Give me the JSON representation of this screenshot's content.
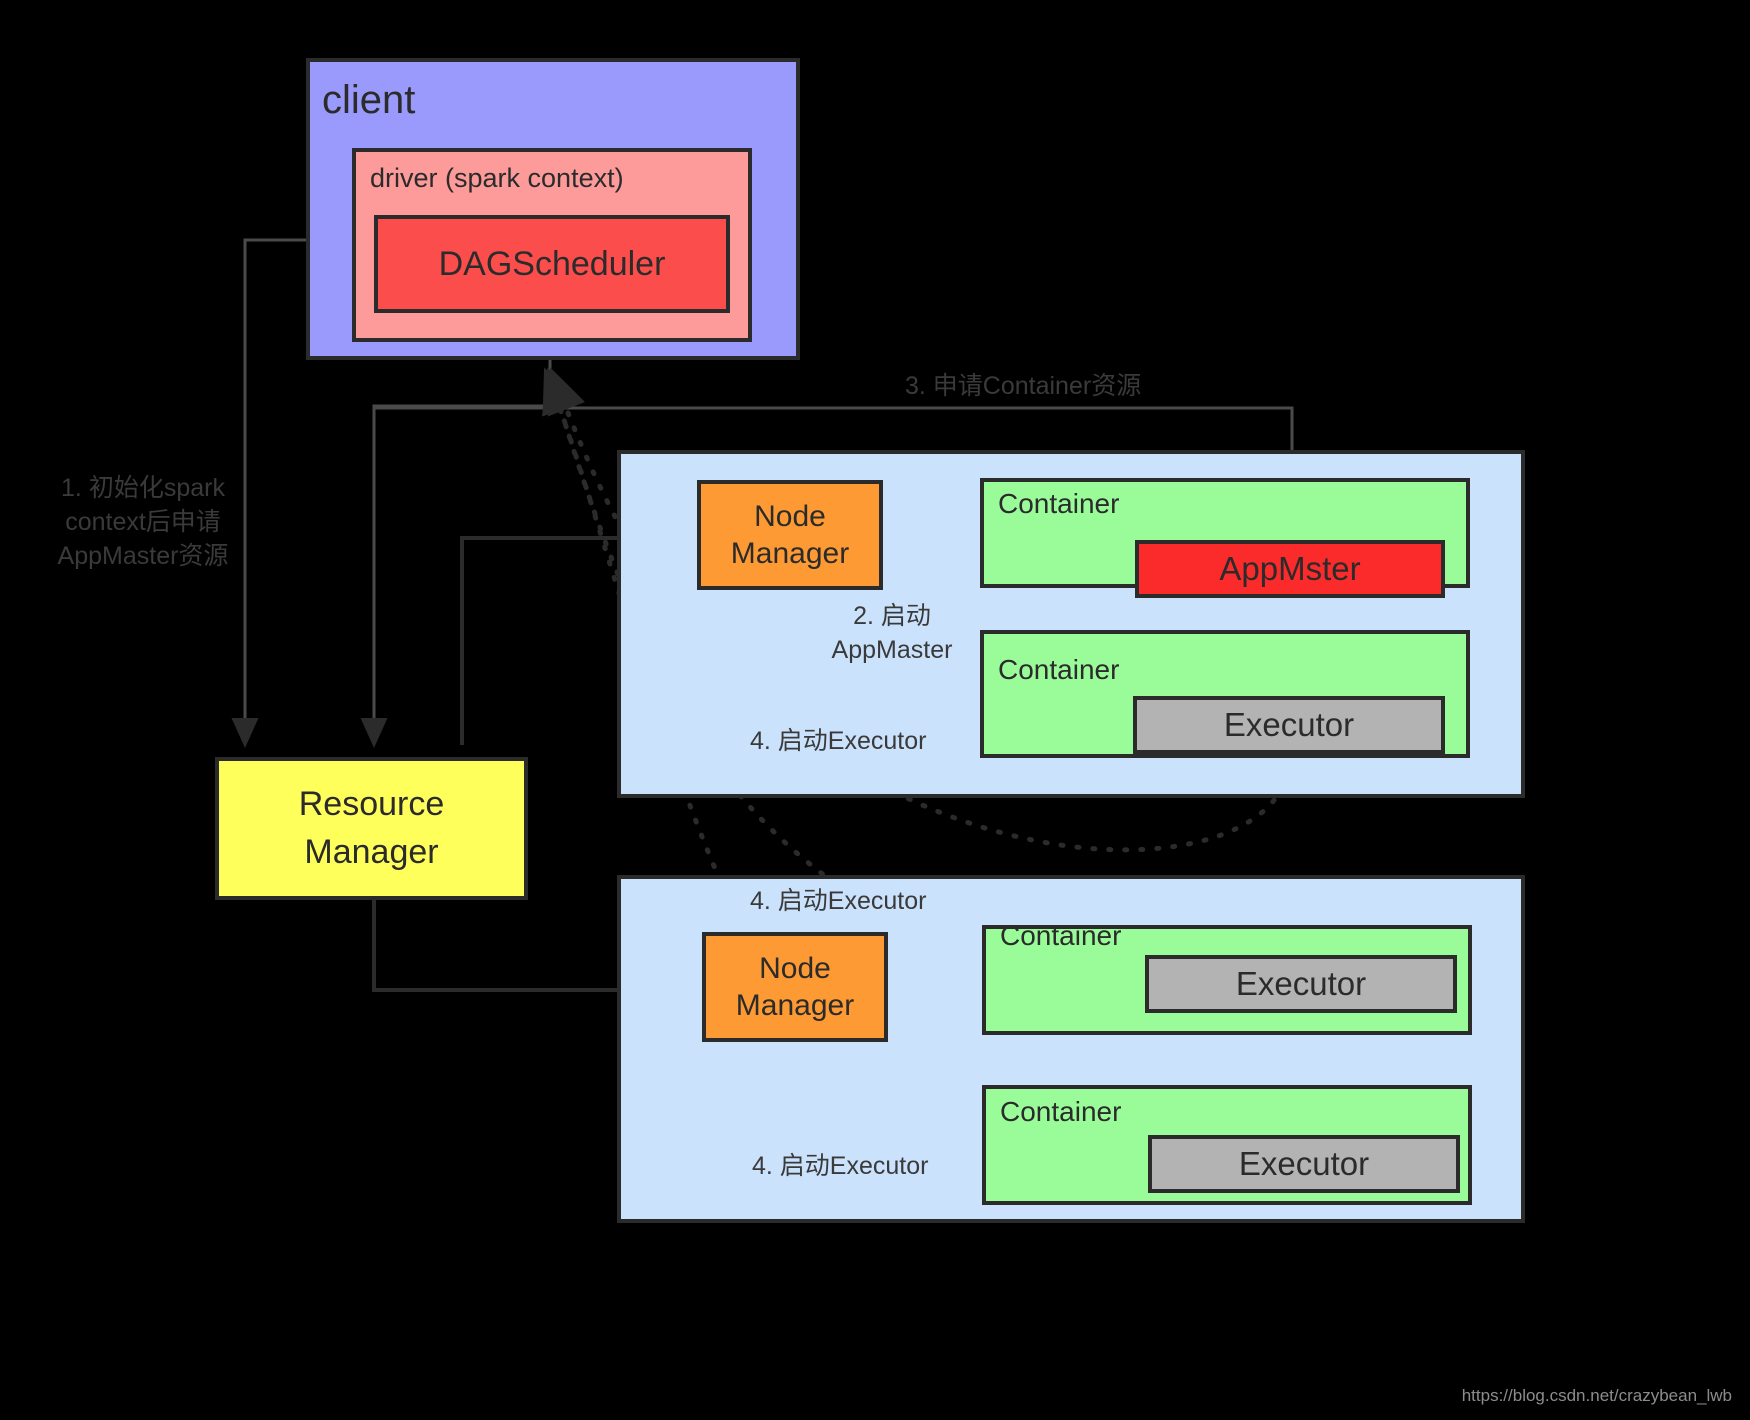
{
  "diagram": {
    "title": "Spark on YARN cluster architecture",
    "background": "#000000",
    "client": {
      "label": "client",
      "fill": "#9a9afc",
      "driver": {
        "label": "driver (spark context)",
        "fill": "#fd9a9a",
        "dagscheduler": {
          "label": "DAGScheduler",
          "fill": "#fc4d4d"
        }
      }
    },
    "resource_manager": {
      "line1": "Resource",
      "line2": "Manager",
      "fill": "#ffff5b"
    },
    "clusters": [
      {
        "fill": "#cbe2fc",
        "node_manager": {
          "line1": "Node",
          "line2": "Manager",
          "fill": "#fd9a33"
        },
        "containers": [
          {
            "label": "Container",
            "fill": "#99fc99",
            "child": {
              "label": "AppMster",
              "fill": "#fc2b2b"
            }
          },
          {
            "label": "Container",
            "fill": "#99fc99",
            "child": {
              "label": "Executor",
              "fill": "#b3b3b3"
            }
          }
        ]
      },
      {
        "fill": "#cbe2fc",
        "node_manager": {
          "line1": "Node",
          "line2": "Manager",
          "fill": "#fd9a33"
        },
        "containers": [
          {
            "label": "Container",
            "fill": "#99fc99",
            "child": {
              "label": "Executor",
              "fill": "#b3b3b3"
            }
          },
          {
            "label": "Container",
            "fill": "#99fc99",
            "child": {
              "label": "Executor",
              "fill": "#b3b3b3"
            }
          }
        ]
      }
    ],
    "steps": {
      "step1_line1": "1. 初始化spark",
      "step1_line2": "context后申请",
      "step1_line3": "AppMaster资源",
      "step2_line1": "2. 启动",
      "step2_line2": "AppMaster",
      "step3": "3. 申请Container资源",
      "step4_a": "4. 启动Executor",
      "step4_b": "4. 启动Executor",
      "step4_c": "4. 启动Executor"
    },
    "watermark": "https://blog.csdn.net/crazybean_lwb"
  }
}
